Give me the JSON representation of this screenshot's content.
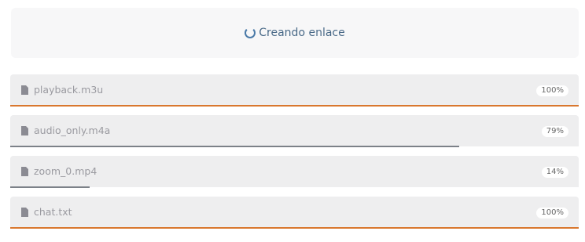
{
  "status": {
    "icon": "spinner-icon",
    "text": "Creando enlace"
  },
  "files": [
    {
      "name": "playback.m3u",
      "percent_label": "100%",
      "progress": 1.0,
      "bar_color": "#d9772e",
      "icon": "file-icon"
    },
    {
      "name": "audio_only.m4a",
      "percent_label": "79%",
      "progress": 0.79,
      "bar_color": "#7c8188",
      "icon": "file-icon"
    },
    {
      "name": "zoom_0.mp4",
      "percent_label": "14%",
      "progress": 0.14,
      "bar_color": "#7c8188",
      "icon": "file-icon"
    },
    {
      "name": "chat.txt",
      "percent_label": "100%",
      "progress": 1.0,
      "bar_color": "#d9772e",
      "icon": "file-icon"
    }
  ]
}
